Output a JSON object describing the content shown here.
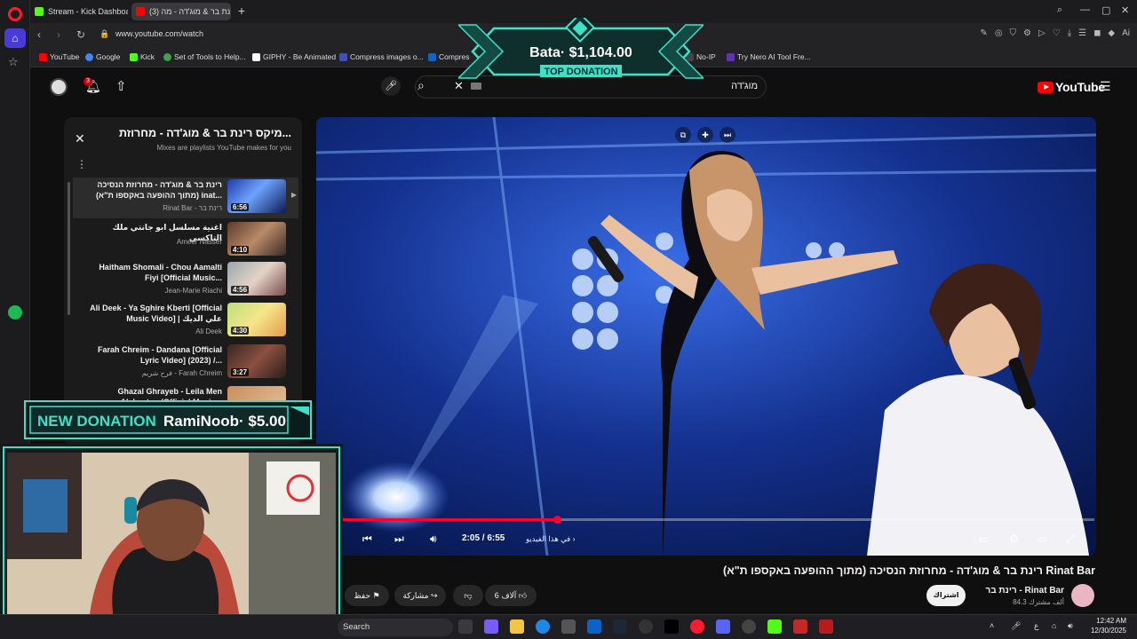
{
  "browser": {
    "tabs": [
      {
        "label": "Stream - Kick Dashboard"
      },
      {
        "label": "(3) רינת בר & מוג'דה - מה"
      }
    ],
    "url": "www.youtube.com/watch",
    "bookmarks": [
      {
        "label": "YouTube",
        "color": "#ff0000"
      },
      {
        "label": "Google",
        "color": "#4285f4"
      },
      {
        "label": "Kick",
        "color": "#53fc18"
      },
      {
        "label": "Set of Tools to Help...",
        "color": "#2e7d32"
      },
      {
        "label": "GIPHY - Be Animated",
        "color": "#ffffff"
      },
      {
        "label": "Compress images o...",
        "color": "#3f51b5"
      },
      {
        "label": "Compres",
        "color": "#1565c0"
      },
      {
        "label": "No-IP",
        "color": "#444444"
      },
      {
        "label": "Try Nero AI Tool Fre...",
        "color": "#5e35b1"
      }
    ]
  },
  "youtube": {
    "notifications_count": "3",
    "search_value": "מוג'דה",
    "logo_text": "YouTube",
    "playlist": {
      "title": "מיקס רינת בר & מוג'דה - מחרוזת...",
      "subtitle": "Mixes are playlists YouTube makes for you",
      "items": [
        {
          "title": "רינת בר & מוג'דה - מחרוזת הנסיכה (מתוך ההופעה באקספו ת\"א) inat...",
          "channel": "Rinat Bar - רינת בר",
          "duration": "6:56",
          "active": true
        },
        {
          "title": "اغنية مسلسل ابو جانتي ملك التاكسي",
          "channel": "Ameer Nasser",
          "duration": "4:10",
          "active": false
        },
        {
          "title": "Haitham Shomali - Chou Aamalti Fiyi [Official Music...",
          "channel": "Jean-Marie Riachi",
          "duration": "4:56",
          "active": false
        },
        {
          "title": "Ali Deek - Ya Sghire Kberti [Official Music Video] | علي الديك",
          "channel": "Ali Deek",
          "duration": "4:30",
          "active": false
        },
        {
          "title": "Farah Chreim - Dandana [Official Lyric Video] (2023) /...",
          "channel": "فرح شريم - Farah Chreim",
          "duration": "3:27",
          "active": false
        },
        {
          "title": "Ghazal Ghrayeb - Leila Men Alshaytan (Official Music...",
          "channel": "",
          "duration": "",
          "active": false
        }
      ]
    },
    "player": {
      "time": "2:05 / 6:55",
      "chapter": "في هذا الفيديو",
      "progress": 0.3
    },
    "video": {
      "title": "רינת בר & מוג'דה - מחרוזת הנסיכה (מתוך ההופעה באקספו ת\"א) Rinat Bar",
      "channel": "רינת בר - Rinat Bar",
      "subscribers": "84.3 ألف مشترك",
      "subscribe_label": "اشتراك",
      "likes": "6 آلاف",
      "share_label": "مشاركة",
      "save_label": "حفظ"
    }
  },
  "overlays": {
    "top_donation": {
      "name": "Bata",
      "amount": "$1,104.00",
      "label": "TOP DONATION"
    },
    "new_donation": {
      "label": "NEW DONATION",
      "name": "RamiNoob",
      "amount": "$5.00"
    }
  },
  "taskbar": {
    "search_label": "Search",
    "time": "12:42 AM",
    "date": "12/30/2025",
    "language": "ع"
  }
}
